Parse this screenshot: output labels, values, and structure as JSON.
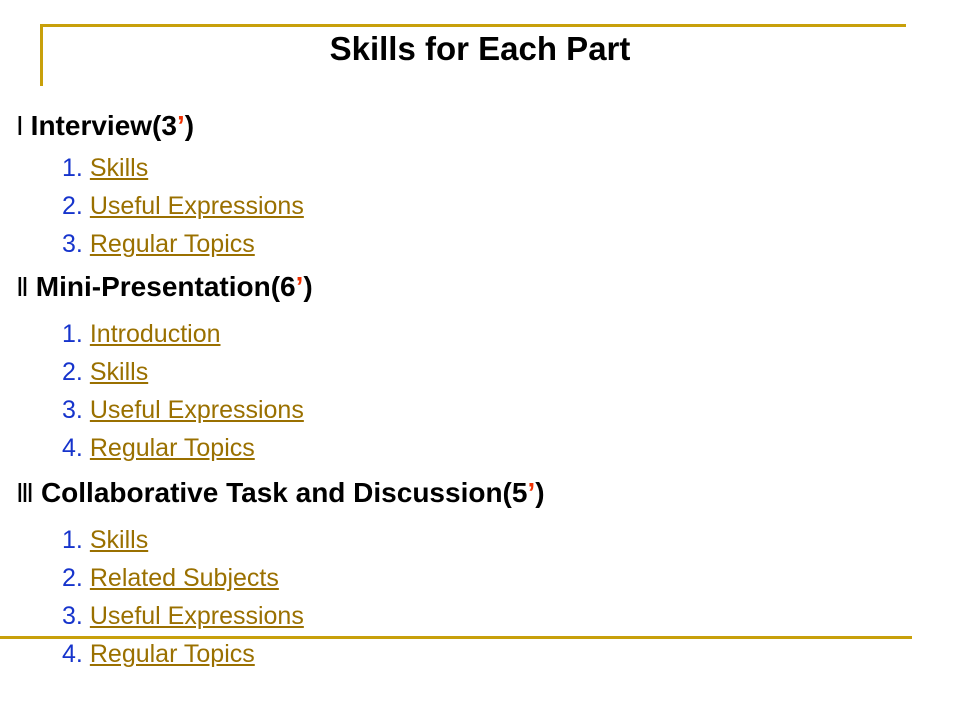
{
  "slide": {
    "title": "Skills for Each Part",
    "accent_gold": "#c8a00a",
    "link_gold": "#9a7000",
    "number_blue": "#1634cc",
    "tick_red": "#f03000",
    "background": "#ffffff"
  },
  "parts": [
    {
      "numeral": "Ⅰ",
      "heading_text": "Interview(3",
      "tick": "’",
      "heading_close": ")",
      "items": [
        {
          "number": "1.",
          "label": "Skills"
        },
        {
          "number": "2.",
          "label": "Useful Expressions"
        },
        {
          "number": "3.",
          "label": "Regular Topics"
        }
      ]
    },
    {
      "numeral": "Ⅱ",
      "heading_text": "Mini-Presentation(6",
      "tick": "’",
      "heading_close": ")",
      "items": [
        {
          "number": "1.",
          "label": "Introduction"
        },
        {
          "number": "2.",
          "label": "Skills"
        },
        {
          "number": "3.",
          "label": "Useful Expressions"
        },
        {
          "number": "4.",
          "label": "Regular Topics"
        }
      ]
    },
    {
      "numeral": "Ⅲ",
      "heading_text": "Collaborative Task and Discussion(5",
      "tick": "’",
      "heading_close": ")",
      "items": [
        {
          "number": "1.",
          "label": "Skills"
        },
        {
          "number": "2.",
          "label": "Related Subjects"
        },
        {
          "number": "3.",
          "label": "Useful Expressions"
        },
        {
          "number": "4.",
          "label": "Regular Topics"
        }
      ]
    }
  ]
}
